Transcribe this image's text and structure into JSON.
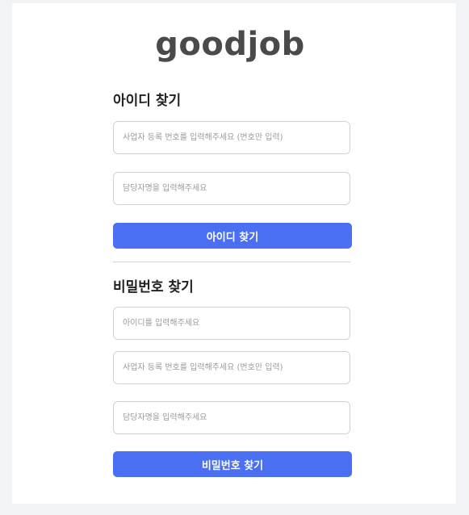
{
  "brand": {
    "logo_text": "goodjob"
  },
  "find_id": {
    "title": "아이디 찾기",
    "business_number_placeholder": "사업자 등록 번호를 입력해주세요 (번호만 입력)",
    "manager_name_placeholder": "담당자명을 입력해주세요",
    "submit_label": "아이디 찾기"
  },
  "find_password": {
    "title": "비밀번호 찾기",
    "user_id_placeholder": "아이디를 입력해주세요",
    "business_number_placeholder": "사업자 등록 번호를 입력해주세요 (번호만 입력)",
    "manager_name_placeholder": "담당자명을 입력해주세요",
    "submit_label": "비밀번호 찾기"
  },
  "colors": {
    "primary_button": "#4a6ff2",
    "page_background": "#f1f3f6"
  }
}
